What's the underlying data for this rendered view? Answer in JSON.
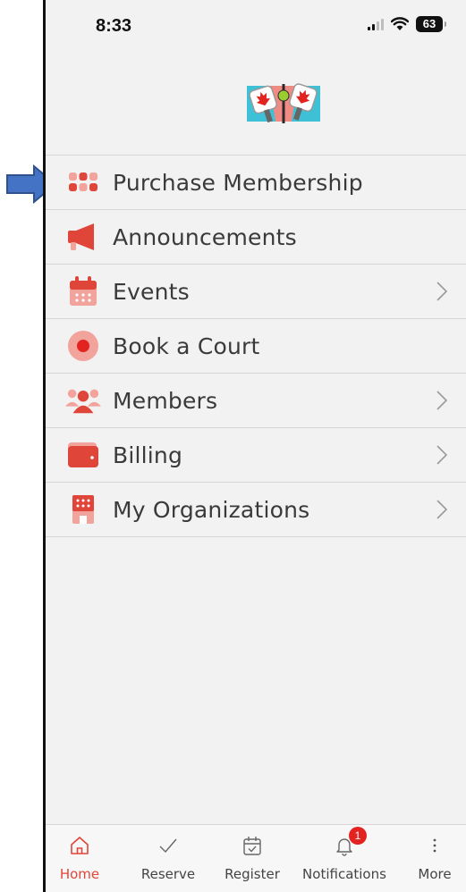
{
  "status_bar": {
    "time": "8:33",
    "battery": "63",
    "icons": [
      "signal-icon",
      "wifi-icon",
      "battery-icon"
    ]
  },
  "logo": {
    "icon": "club-logo-icon"
  },
  "menu": {
    "items": [
      {
        "label": "Purchase Membership",
        "icon": "grid-dots-icon",
        "chevron": false
      },
      {
        "label": "Announcements",
        "icon": "megaphone-icon",
        "chevron": false
      },
      {
        "label": "Events",
        "icon": "calendar-icon",
        "chevron": true
      },
      {
        "label": "Book a Court",
        "icon": "circle-target-icon",
        "chevron": false
      },
      {
        "label": "Members",
        "icon": "people-icon",
        "chevron": true
      },
      {
        "label": "Billing",
        "icon": "wallet-icon",
        "chevron": true
      },
      {
        "label": "My Organizations",
        "icon": "building-icon",
        "chevron": true
      }
    ]
  },
  "tab_bar": {
    "tabs": [
      {
        "label": "Home",
        "icon": "home-icon",
        "active": true
      },
      {
        "label": "Reserve",
        "icon": "checkmark-icon",
        "active": false
      },
      {
        "label": "Register",
        "icon": "calendar-check-icon",
        "active": false
      },
      {
        "label": "Notifications",
        "icon": "bell-icon",
        "active": false,
        "badge": "1"
      },
      {
        "label": "More",
        "icon": "more-vertical-icon",
        "active": false
      }
    ]
  },
  "colors": {
    "accent": "#e0453a",
    "icon_light": "#f2a39b",
    "arrow_blue": "#4472c4",
    "badge": "#e3231f"
  }
}
